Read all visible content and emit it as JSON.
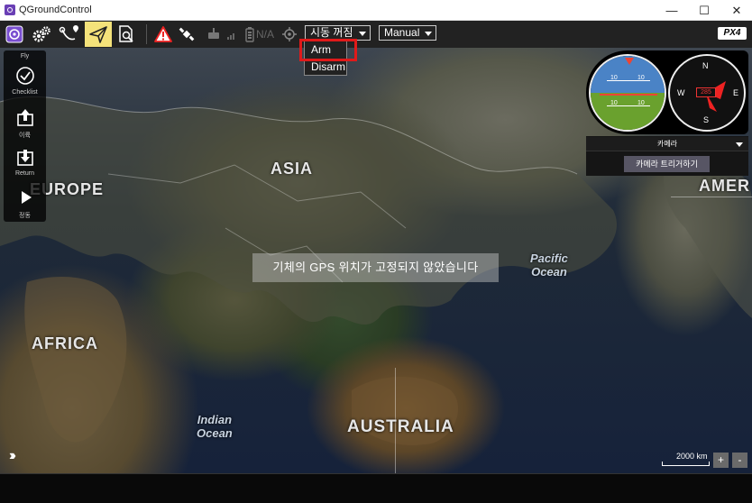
{
  "window": {
    "title": "QGroundControl",
    "minimize": "—",
    "maximize": "☐",
    "close": "✕"
  },
  "toolbar": {
    "gps_status": "N/A",
    "arm_dropdown": "시동 꺼짐",
    "flight_mode": "Manual",
    "logo": "PX4"
  },
  "arm_menu": {
    "items": [
      "Arm",
      "Disarm"
    ]
  },
  "left_tools": {
    "header": "Fly",
    "items": [
      {
        "label": "Checklist",
        "icon": "checklist-icon"
      },
      {
        "label": "이륙",
        "icon": "takeoff-icon"
      },
      {
        "label": "Return",
        "icon": "return-icon"
      },
      {
        "label": "정동",
        "icon": "play-icon"
      }
    ]
  },
  "map": {
    "labels": {
      "asia": "ASIA",
      "europe": "EUROPE",
      "africa": "AFRICA",
      "australia": "AUSTRALIA",
      "america": "AMER",
      "pacific": "Pacific\nOcean",
      "indian": "Indian\nOcean"
    },
    "status_message": "기체의 GPS 위치가 고정되지 않았습니다",
    "scale": "2000 km",
    "zoom_in": "+",
    "zoom_out": "-"
  },
  "instruments": {
    "attitude_ticks": [
      "10",
      "10",
      "10",
      "10"
    ],
    "compass_letters": {
      "n": "N",
      "e": "E",
      "s": "S",
      "w": "W"
    },
    "heading": "285"
  },
  "camera": {
    "select_label": "카메라",
    "trigger_label": "카메라 트리거하기"
  },
  "colors": {
    "toolbar_bg": "#222222",
    "active_tool": "#f4e27a",
    "highlight": "#e01a1a",
    "sky": "#4a83c6",
    "ground": "#6aa12e"
  }
}
